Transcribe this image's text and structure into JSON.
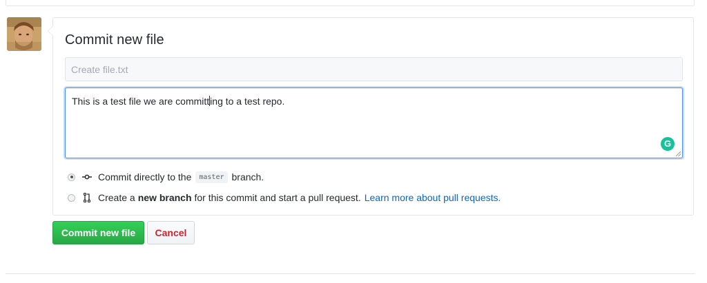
{
  "commit_form": {
    "title": "Commit new file",
    "summary_placeholder": "Create file.txt",
    "summary_value": "",
    "description_before_caret": "This is a test file we are committ",
    "description_after_caret": "ing to a test repo.",
    "grammarly_glyph": "G",
    "option_direct": {
      "prefix": "Commit directly to the",
      "branch": "master",
      "suffix": "branch."
    },
    "option_new_branch": {
      "prefix": "Create a",
      "bold": "new branch",
      "suffix": "for this commit and start a pull request.",
      "link": "Learn more about pull requests."
    },
    "selected_option": "direct",
    "commit_button": "Commit new file",
    "cancel_button": "Cancel"
  },
  "colors": {
    "commit_green": "#28a745",
    "cancel_red": "#cb2431",
    "link_blue": "#0366d6",
    "focus_blue": "#4f8ff0",
    "grammarly_green": "#15c39a"
  },
  "icons": {
    "commit": "git-commit-icon",
    "pull_request": "git-pull-request-icon",
    "grammarly": "grammarly-icon",
    "avatar": "user-avatar"
  }
}
